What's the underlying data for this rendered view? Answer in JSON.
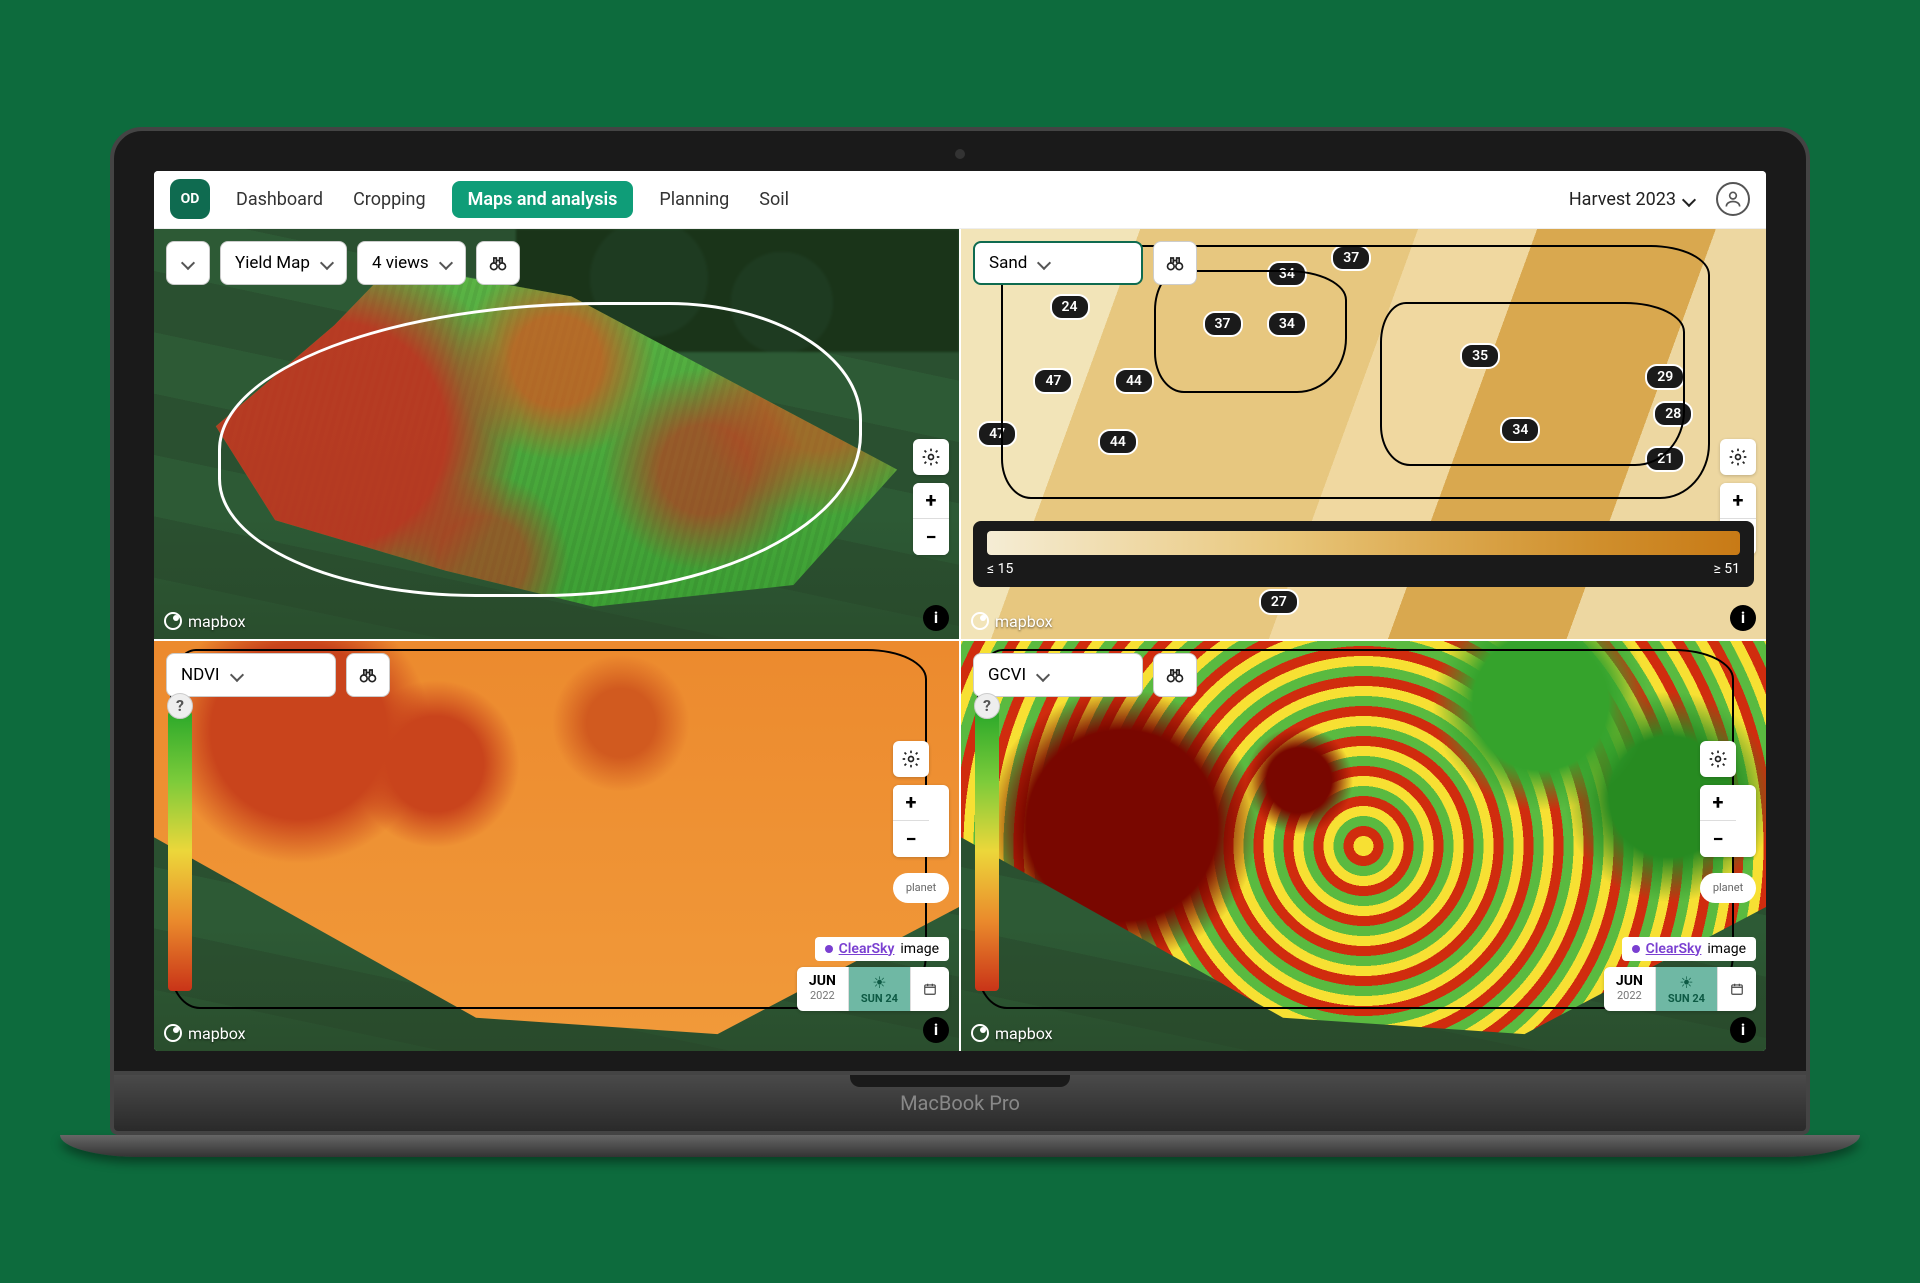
{
  "brand": "OD",
  "device_label": "MacBook Pro",
  "nav": {
    "items": [
      "Dashboard",
      "Cropping",
      "Maps and analysis",
      "Planning",
      "Soil"
    ],
    "active_index": 2,
    "season_label": "Harvest 2023"
  },
  "attribution": "mapbox",
  "panels": {
    "yield": {
      "layer_dropdown": "Yield Map",
      "views_dropdown": "4 views"
    },
    "sand": {
      "layer_dropdown": "Sand",
      "legend": {
        "min_label": "≤ 15",
        "max_label": "≥ 51"
      },
      "zone_values": [
        37,
        24,
        37,
        34,
        34,
        47,
        44,
        35,
        29,
        28,
        47,
        44,
        34,
        21,
        27
      ]
    },
    "ndvi": {
      "layer_dropdown": "NDVI",
      "legend_help": "?",
      "imagery": {
        "provider": "planet",
        "source_link": "ClearSky",
        "source_suffix": "image",
        "month": "JUN",
        "year": "2022",
        "day_of_week": "SUN 24"
      }
    },
    "gcvi": {
      "layer_dropdown": "GCVI",
      "legend_help": "?",
      "imagery": {
        "provider": "planet",
        "source_link": "ClearSky",
        "source_suffix": "image",
        "month": "JUN",
        "year": "2022",
        "day_of_week": "SUN 24"
      }
    }
  },
  "icons": {
    "gear": "⚙",
    "plus": "+",
    "minus": "−",
    "info": "i",
    "calendar": "📅",
    "sun": "☀"
  }
}
